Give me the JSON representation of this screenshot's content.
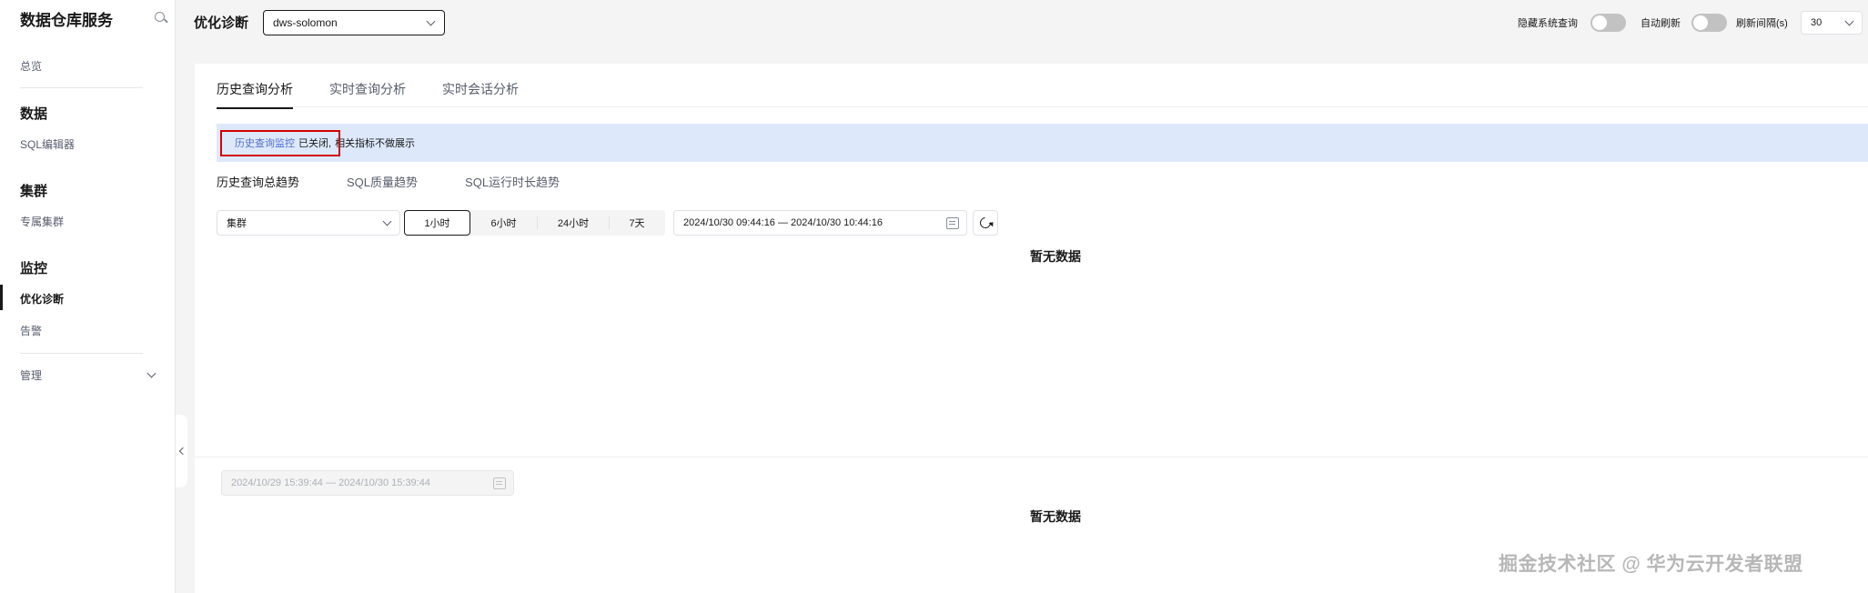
{
  "sidebar": {
    "title": "数据仓库服务",
    "items": {
      "overview": "总览",
      "group_data": "数据",
      "sql_editor": "SQL编辑器",
      "group_cluster": "集群",
      "dedicated_cluster": "专属集群",
      "group_monitor": "监控",
      "optimization": "优化诊断",
      "alarm": "告警",
      "manage": "管理"
    }
  },
  "header": {
    "title": "优化诊断",
    "instance": "dws-solomon",
    "hide_system_query": "隐藏系统查询",
    "auto_refresh": "自动刷新",
    "refresh_interval_label": "刷新间隔(s)",
    "refresh_interval_value": "30"
  },
  "tabs": [
    "历史查询分析",
    "实时查询分析",
    "实时会话分析"
  ],
  "alert": {
    "link": "历史查询监控",
    "status": "已关闭,",
    "message": "相关指标不做展示"
  },
  "subtabs": [
    "历史查询总趋势",
    "SQL质量趋势",
    "SQL运行时长趋势"
  ],
  "filters": {
    "cluster_select": "集群",
    "ranges": [
      "1小时",
      "6小时",
      "24小时",
      "7天"
    ],
    "date_range": "2024/10/30 09:44:16 — 2024/10/30 10:44:16"
  },
  "chart1": {
    "empty_text": "暂无数据"
  },
  "chart2": {
    "date_range": "2024/10/29 15:39:44 — 2024/10/30 15:39:44",
    "empty_text": "暂无数据"
  },
  "watermark": "掘金技术社区 @ 华为云开发者联盟"
}
